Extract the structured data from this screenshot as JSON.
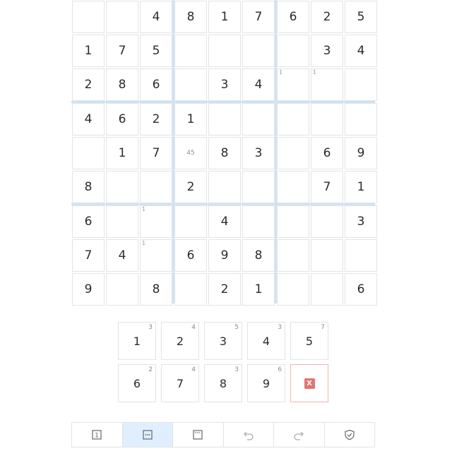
{
  "board": {
    "rows": [
      [
        "",
        "",
        "4",
        "8",
        "1",
        "7",
        "6",
        "2",
        "5"
      ],
      [
        "1",
        "7",
        "5",
        "",
        "",
        "",
        "",
        "3",
        "4"
      ],
      [
        "2",
        "8",
        "6",
        "",
        "3",
        "4",
        "",
        "",
        ""
      ],
      [
        "4",
        "6",
        "2",
        "1",
        "",
        "",
        "",
        "",
        ""
      ],
      [
        "",
        "1",
        "7",
        "",
        "8",
        "3",
        "",
        "6",
        "9"
      ],
      [
        "8",
        "",
        "",
        "2",
        "",
        "",
        "",
        "7",
        "1"
      ],
      [
        "6",
        "",
        "",
        "",
        "4",
        "",
        "",
        "",
        "3"
      ],
      [
        "7",
        "4",
        "",
        "6",
        "9",
        "8",
        "",
        "",
        ""
      ],
      [
        "9",
        "",
        "8",
        "",
        "2",
        "1",
        "",
        "",
        "6"
      ]
    ],
    "corner_notes": [
      {
        "row": 2,
        "col": 6,
        "text": "1"
      },
      {
        "row": 2,
        "col": 7,
        "text": "1"
      },
      {
        "row": 6,
        "col": 2,
        "text": "1"
      },
      {
        "row": 7,
        "col": 2,
        "text": "1"
      }
    ],
    "center_notes": [
      {
        "row": 4,
        "col": 3,
        "text": "45"
      }
    ]
  },
  "numpad": {
    "buttons": [
      {
        "digit": "1",
        "remaining": "3"
      },
      {
        "digit": "2",
        "remaining": "4"
      },
      {
        "digit": "3",
        "remaining": "5"
      },
      {
        "digit": "4",
        "remaining": "3"
      },
      {
        "digit": "5",
        "remaining": "7"
      },
      {
        "digit": "6",
        "remaining": "2"
      },
      {
        "digit": "7",
        "remaining": "4"
      },
      {
        "digit": "8",
        "remaining": "3"
      },
      {
        "digit": "9",
        "remaining": "6"
      }
    ],
    "erase_label": "X"
  },
  "toolbar": {
    "tools": [
      {
        "icon": "single-number-mode-icon",
        "label": "1",
        "active": false
      },
      {
        "icon": "center-notes-mode-icon",
        "active": true
      },
      {
        "icon": "corner-notes-mode-icon",
        "active": false
      },
      {
        "icon": "undo-icon",
        "active": false
      },
      {
        "icon": "redo-icon",
        "active": false
      },
      {
        "icon": "check-shield-icon",
        "active": false
      }
    ]
  },
  "colors": {
    "box_line": "#cfe3f7",
    "active_tool": "#e0efff",
    "erase": "#e57373"
  }
}
